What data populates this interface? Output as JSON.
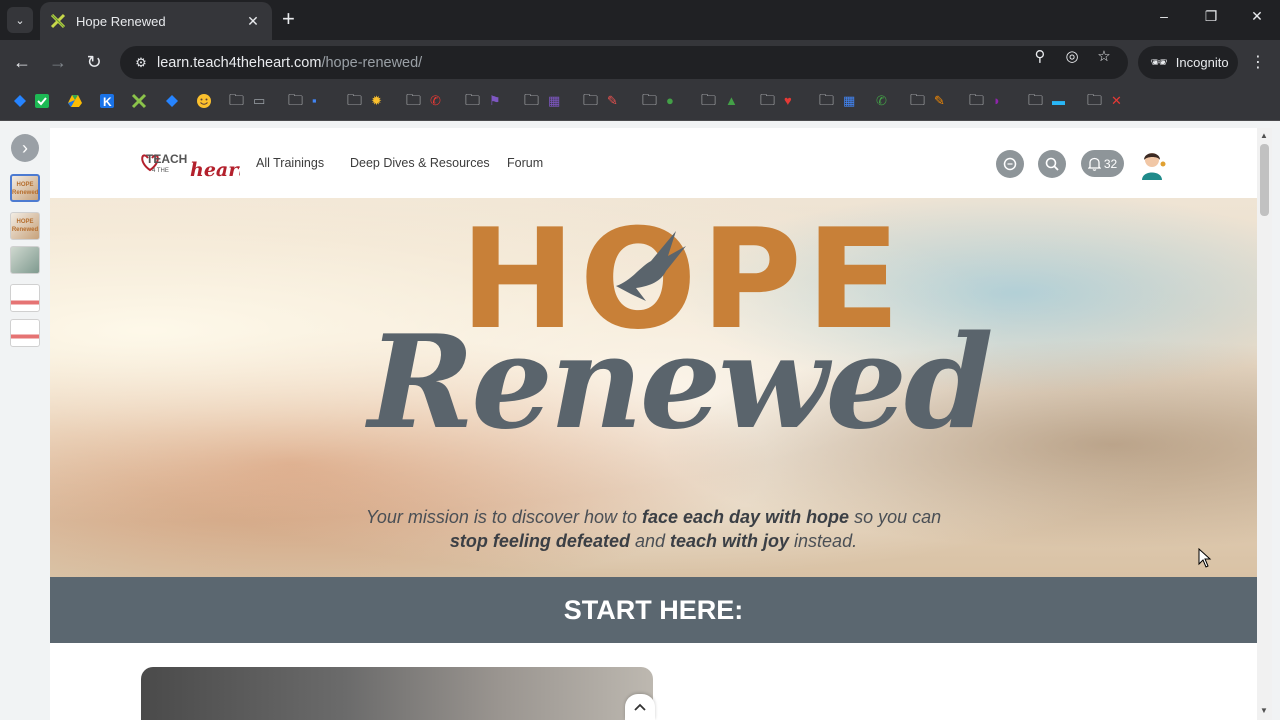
{
  "browser": {
    "tab_title": "Hope Renewed",
    "tab_close": "✕",
    "new_tab": "+",
    "url_host": "learn.teach4theheart.com",
    "url_path": "/hope-renewed/",
    "incognito_label": "Incognito",
    "window_controls": [
      "–",
      "❐",
      "✕"
    ]
  },
  "bookmarks": [
    {
      "icon": "jira-icon",
      "color": "#2684ff"
    },
    {
      "icon": "check-icon",
      "color": "#1db954"
    },
    {
      "icon": "drive-icon",
      "color": "#fbbc04"
    },
    {
      "icon": "k-icon",
      "color": "#1a73e8"
    },
    {
      "icon": "x-icon",
      "color": "#8bc34a"
    },
    {
      "icon": "jira-icon",
      "color": "#2684ff"
    },
    {
      "icon": "smile-icon",
      "color": "#fbc02d"
    }
  ],
  "site": {
    "nav": [
      "All Trainings",
      "Deep Dives & Resources",
      "Forum"
    ],
    "notification_count": "32",
    "logo_text_1": "TEACH",
    "logo_text_2": "4 THE",
    "logo_text_3": "heart"
  },
  "hero": {
    "title_top": "HOPE",
    "title_script": "Renewed",
    "mission_parts": [
      "Your mission is to discover how to ",
      "face each day with hope",
      " so you can ",
      "stop feeling defeated",
      " and ",
      "teach with joy",
      " instead."
    ]
  },
  "start_here": "START HERE:",
  "thumbnails": [
    {
      "label": "HOPE Renewed"
    },
    {
      "label": "HOPE Renewed"
    },
    {
      "label": ""
    },
    {
      "label": ""
    },
    {
      "label": ""
    }
  ],
  "colors": {
    "hope_orange": "#c88038",
    "renewed_gray": "#5a646c",
    "start_bar": "#5b6770"
  }
}
